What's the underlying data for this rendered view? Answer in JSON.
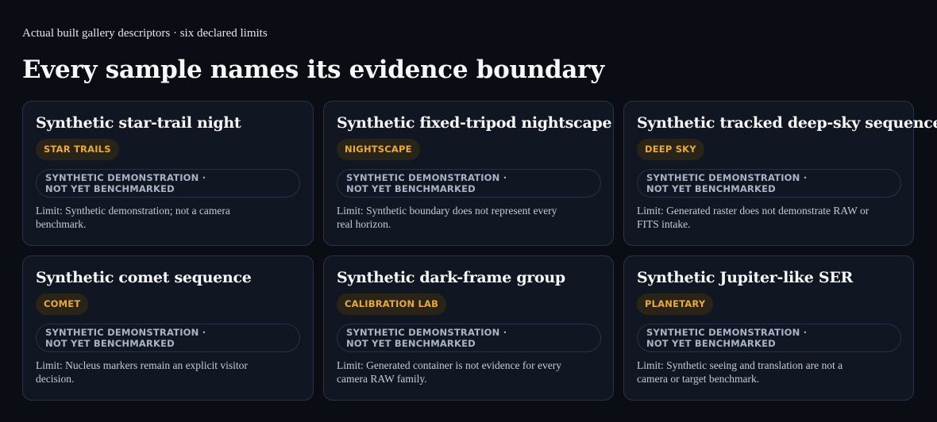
{
  "header": {
    "eyebrow": "Actual built gallery descriptors · six declared limits",
    "title": "Every sample names its evidence boundary"
  },
  "cards": [
    {
      "title": "Synthetic star-trail night",
      "category": "STAR TRAILS",
      "status": "SYNTHETIC DEMONSTRATION · NOT YET BENCHMARKED",
      "limit": "Limit: Synthetic demonstration; not a camera benchmark."
    },
    {
      "title": "Synthetic fixed-tripod nightscape",
      "category": "NIGHTSCAPE",
      "status": "SYNTHETIC DEMONSTRATION · NOT YET BENCHMARKED",
      "limit": "Limit: Synthetic boundary does not represent every real horizon."
    },
    {
      "title": "Synthetic tracked deep-sky sequence",
      "category": "DEEP SKY",
      "status": "SYNTHETIC DEMONSTRATION · NOT YET BENCHMARKED",
      "limit": "Limit: Generated raster does not demonstrate RAW or FITS intake."
    },
    {
      "title": "Synthetic comet sequence",
      "category": "COMET",
      "status": "SYNTHETIC DEMONSTRATION · NOT YET BENCHMARKED",
      "limit": "Limit: Nucleus markers remain an explicit visitor decision."
    },
    {
      "title": "Synthetic dark-frame group",
      "category": "CALIBRATION LAB",
      "status": "SYNTHETIC DEMONSTRATION · NOT YET BENCHMARKED",
      "limit": "Limit: Generated container is not evidence for every camera RAW family."
    },
    {
      "title": "Synthetic Jupiter-like SER",
      "category": "PLANETARY",
      "status": "SYNTHETIC DEMONSTRATION · NOT YET BENCHMARKED",
      "limit": "Limit: Synthetic seeing and translation are not a camera or target benchmark."
    }
  ],
  "colors": {
    "background": "#0a0d14",
    "card_background": "#111722",
    "card_border": "#2a3345",
    "category_text": "#e8a83e",
    "category_background": "#2a2418",
    "status_text": "#a9b3c6"
  }
}
